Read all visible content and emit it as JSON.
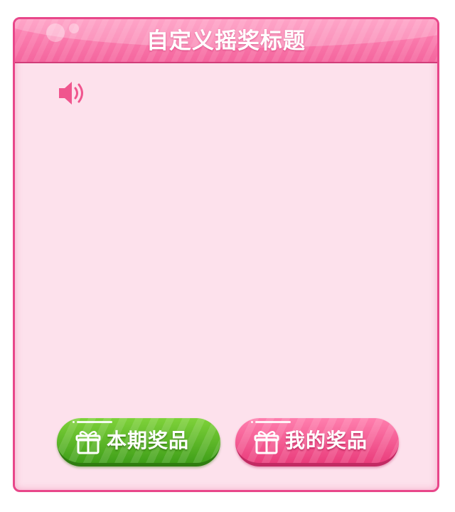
{
  "header": {
    "title": "自定义摇奖标题"
  },
  "controls": {
    "sound_icon": "speaker-icon"
  },
  "buttons": {
    "current_prizes_label": "本期奖品",
    "my_prizes_label": "我的奖品",
    "gift_icon": "gift-icon"
  },
  "colors": {
    "accent_pink": "#f4669e",
    "frame_border": "#e8478a",
    "panel_background": "#fde1ec",
    "button_green": "#5cb82a",
    "button_pink": "#f0558e"
  }
}
